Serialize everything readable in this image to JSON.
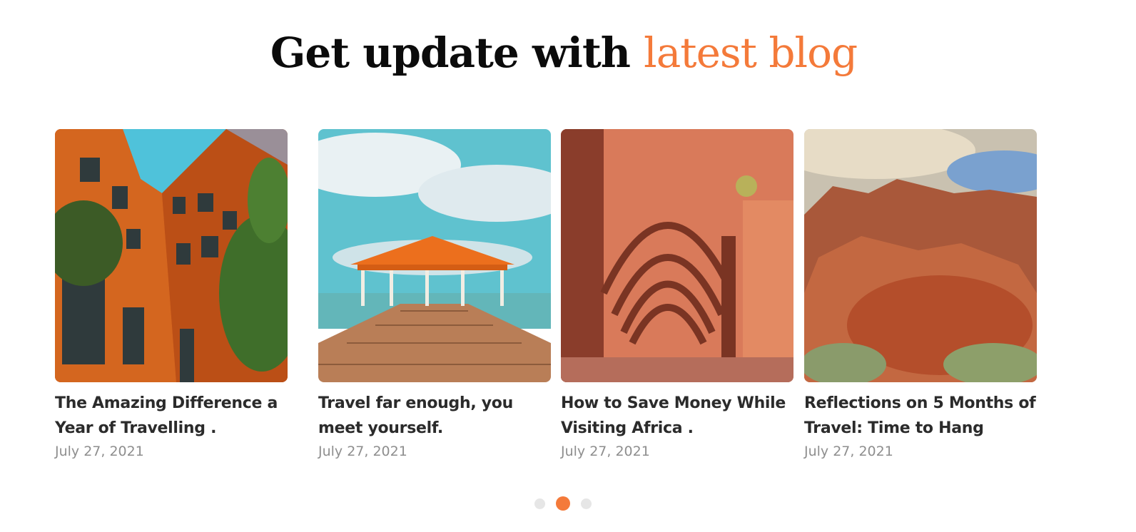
{
  "heading": {
    "text_main": "Get update with",
    "text_accent": "latest blog"
  },
  "colors": {
    "accent": "#f47a3a",
    "title": "#2b2b2b",
    "date": "#8e8e8e",
    "dot_inactive": "#e6e6e6"
  },
  "posts": [
    {
      "title": "The Amazing Difference a Year of Travelling .",
      "date": "July 27, 2021",
      "image": "orange-building-courtyard-photo"
    },
    {
      "title": "Travel far enough, you meet yourself.",
      "date": "July 27, 2021",
      "image": "pier-gazebo-sea-photo"
    },
    {
      "title": "How to Save Money While Visiting Africa .",
      "date": "July 27, 2021",
      "image": "arched-portico-street-photo"
    },
    {
      "title": "Reflections on 5 Months of Travel: Time to Hang",
      "date": "July 27, 2021",
      "image": "red-rock-canyon-photo"
    }
  ],
  "pagination": {
    "count": 3,
    "active": 2
  }
}
